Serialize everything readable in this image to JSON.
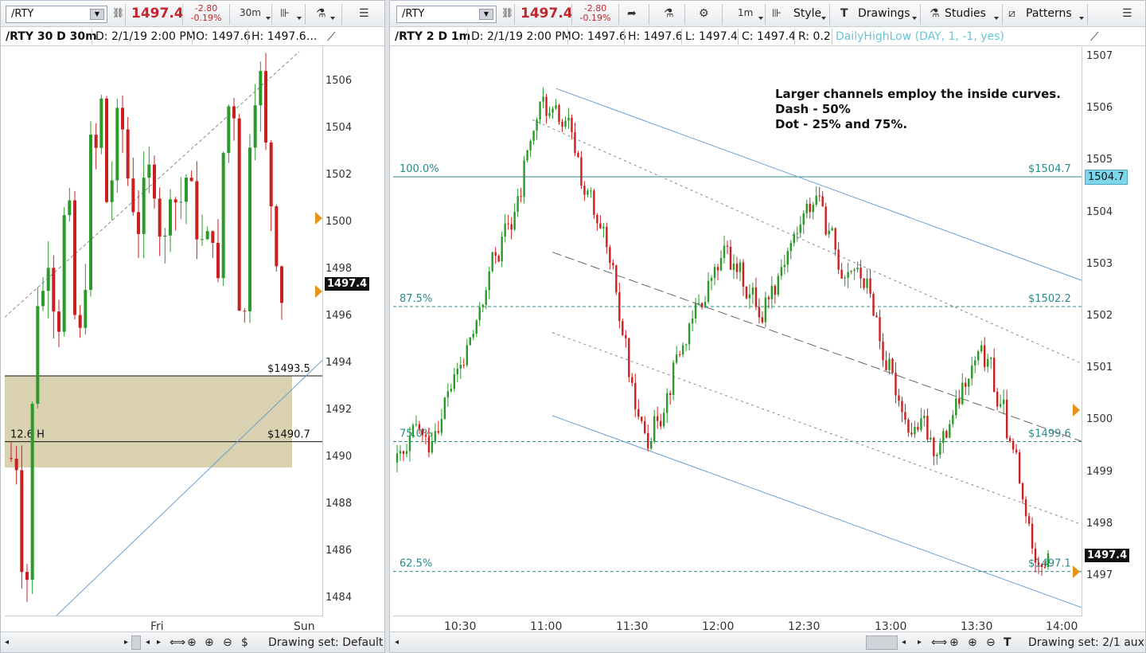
{
  "left": {
    "symbol": "/RTY",
    "last_price": "1497.4",
    "change_abs": "-2.80",
    "change_pct": "-0.19%",
    "timeframe_btn": "30m",
    "header": {
      "title": "/RTY 30 D 30m",
      "date": "D: 2/1/19 2:00 PM",
      "open": "O: 1497.6",
      "high": "H: 1497.6",
      "more": "..."
    },
    "y_ticks": [
      "1506",
      "1504",
      "1502",
      "1500",
      "1498",
      "1496",
      "1494",
      "1492",
      "1490",
      "1488",
      "1486",
      "1484"
    ],
    "x_ticks": [
      "Fri",
      "Sun"
    ],
    "price_tag": "1497.4",
    "levels": [
      {
        "label": "$1493.5",
        "price": 1493.5
      },
      {
        "label": "$1490.7",
        "price": 1490.7
      }
    ],
    "zone_label": "12.6 H",
    "footer": {
      "drawing_set": "Drawing set: Default"
    }
  },
  "right": {
    "symbol": "/RTY",
    "last_price": "1497.4",
    "change_abs": "-2.80",
    "change_pct": "-0.19%",
    "timeframe_btn": "1m",
    "buttons": {
      "style": "Style",
      "drawings": "Drawings",
      "studies": "Studies",
      "patterns": "Patterns"
    },
    "header": {
      "title": "/RTY 2 D 1m",
      "date": "D: 2/1/19 2:00 PM",
      "open": "O: 1497.6",
      "high": "H: 1497.6",
      "low": "L: 1497.4",
      "close": "C: 1497.4",
      "range": "R: 0.2",
      "study": "DailyHighLow (DAY, 1, -1, yes)"
    },
    "y_ticks": [
      "1507",
      "1506",
      "1505",
      "1504",
      "1503",
      "1502",
      "1501",
      "1500",
      "1499",
      "1498",
      "1497"
    ],
    "x_ticks": [
      "10:30",
      "11:00",
      "11:30",
      "12:00",
      "12:30",
      "13:00",
      "13:30",
      "14:00"
    ],
    "price_tag": "1497.4",
    "level_tag": "1504.7",
    "fib_levels": [
      {
        "pct": "100.0%",
        "price_label": "$1504.7",
        "price": 1504.7
      },
      {
        "pct": "87.5%",
        "price_label": "$1502.2",
        "price": 1502.2
      },
      {
        "pct": "75.0%",
        "price_label": "$1499.6",
        "price": 1499.6
      },
      {
        "pct": "62.5%",
        "price_label": "$1497.1",
        "price": 1497.1
      }
    ],
    "annotation": {
      "line1": "Larger channels employ the inside curves.",
      "line2": "Dash - 50%",
      "line3": "Dot - 25% and 75%."
    },
    "footer": {
      "drawing_set": "Drawing set: 2/1 aux"
    }
  },
  "colors": {
    "up": "#2a9a2a",
    "down": "#cc1f1f",
    "fib": "#2a8a8a",
    "channel": "#6a9ed0",
    "zone": "#d9d1b0",
    "marker": "#e69418"
  }
}
